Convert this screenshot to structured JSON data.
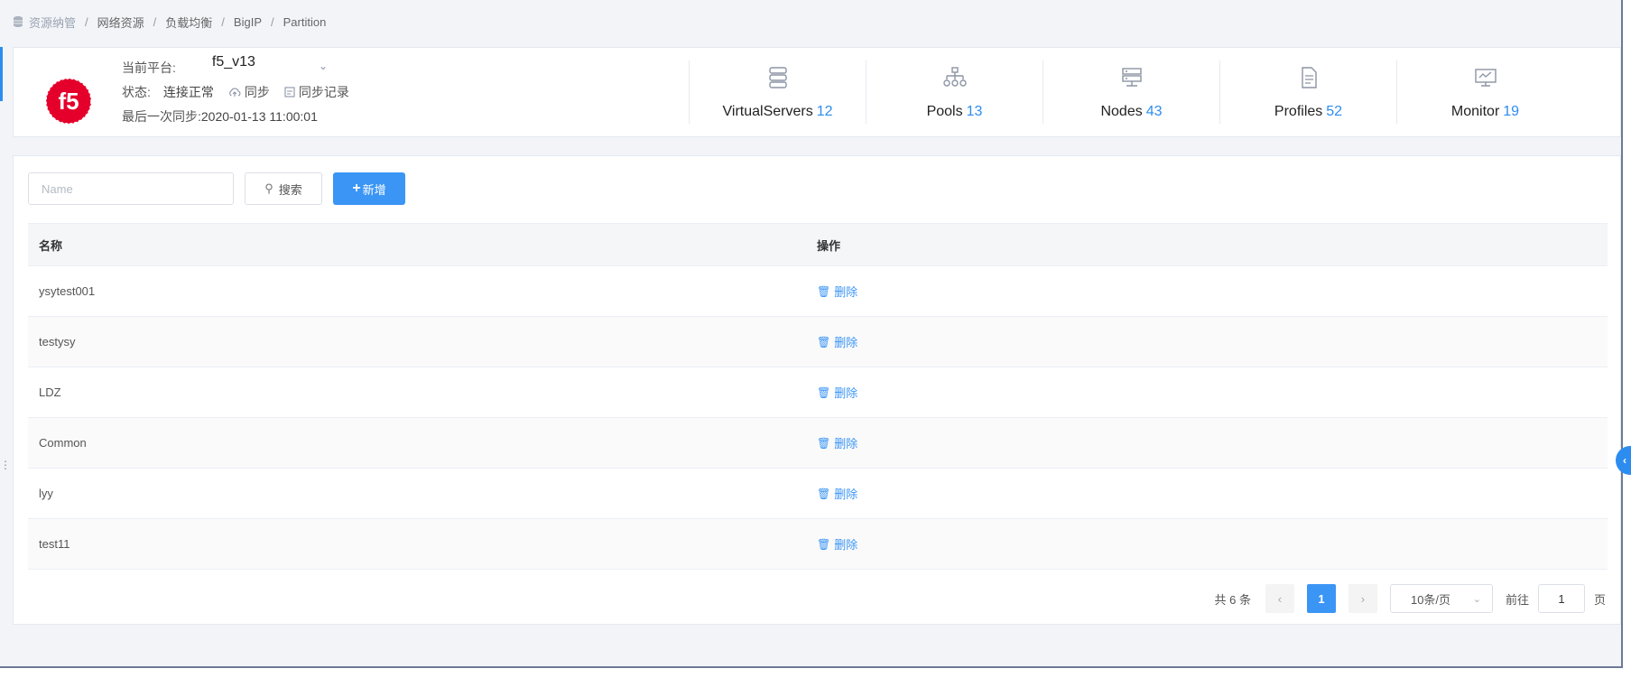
{
  "breadcrumb": [
    "资源纳管",
    "网络资源",
    "负载均衡",
    "BigIP",
    "Partition"
  ],
  "platform": {
    "logo_text": "f5",
    "current_label": "当前平台:",
    "current_value": "f5_v13",
    "status_label": "状态:",
    "status_value": "连接正常",
    "sync_label": "同步",
    "sync_log_label": "同步记录",
    "last_sync_label": "最后一次同步:",
    "last_sync_value": "2020-01-13 11:00:01"
  },
  "stats": [
    {
      "label": "VirtualServers",
      "count": "12",
      "icon": "server-stack-icon"
    },
    {
      "label": "Pools",
      "count": "13",
      "icon": "hierarchy-icon"
    },
    {
      "label": "Nodes",
      "count": "43",
      "icon": "node-server-icon"
    },
    {
      "label": "Profiles",
      "count": "52",
      "icon": "document-icon"
    },
    {
      "label": "Monitor",
      "count": "19",
      "icon": "monitor-icon"
    }
  ],
  "toolbar": {
    "name_placeholder": "Name",
    "search_label": "搜索",
    "add_label": "新增"
  },
  "table": {
    "columns": [
      "名称",
      "操作"
    ],
    "rows": [
      {
        "name": "ysytest001",
        "action": "删除"
      },
      {
        "name": "testysy",
        "action": "删除"
      },
      {
        "name": "LDZ",
        "action": "删除"
      },
      {
        "name": "Common",
        "action": "删除"
      },
      {
        "name": "lyy",
        "action": "删除"
      },
      {
        "name": "test11",
        "action": "删除"
      }
    ]
  },
  "pagination": {
    "total_text": "共 6 条",
    "current_page": "1",
    "page_size": "10条/页",
    "goto_label": "前往",
    "goto_value": "1",
    "page_suffix": "页"
  },
  "colors": {
    "accent": "#3a95f5",
    "logo_red": "#e4002b"
  }
}
